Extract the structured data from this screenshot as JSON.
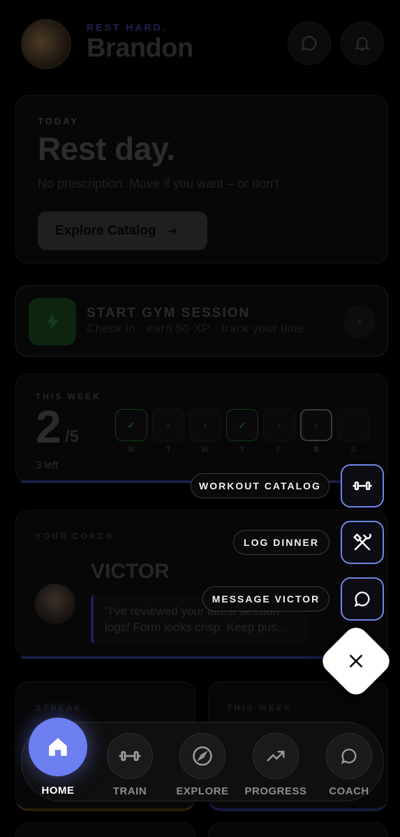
{
  "header": {
    "greeting": "REST HARD.",
    "username": "Brandon",
    "icons": [
      "chat-icon",
      "bell-icon"
    ]
  },
  "today": {
    "label": "TODAY",
    "title": "Rest day.",
    "subtitle": "No prescription. Move if you want – or don't.",
    "button_label": "Explore Catalog"
  },
  "gym_session": {
    "title": "START GYM SESSION",
    "subtitle": "Check in · earn 50 XP · track your time",
    "icon": "lightning-icon"
  },
  "this_week": {
    "label": "THIS WEEK",
    "completed": "2",
    "goal": "/5",
    "remaining": "3 left",
    "days": [
      {
        "letter": "M",
        "state": "done",
        "mark": "✓"
      },
      {
        "letter": "T",
        "state": "empty",
        "mark": "•"
      },
      {
        "letter": "W",
        "state": "empty",
        "mark": "•"
      },
      {
        "letter": "T",
        "state": "done",
        "mark": "✓"
      },
      {
        "letter": "F",
        "state": "empty",
        "mark": "•"
      },
      {
        "letter": "S",
        "state": "today",
        "mark": "•"
      },
      {
        "letter": "S",
        "state": "empty",
        "mark": ""
      }
    ]
  },
  "coach": {
    "label": "YOUR COACH",
    "name": "VICTOR",
    "quote": "\"I've reviewed your latest session logs! Form looks crisp. Keep pus..."
  },
  "stats": {
    "streak_label": "STREAK",
    "week_label": "THIS WEEK"
  },
  "quick_actions": [
    {
      "label": "WORKOUT CATALOG",
      "icon": "dumbbell-icon"
    },
    {
      "label": "LOG DINNER",
      "icon": "fork-knife-icon"
    },
    {
      "label": "MESSAGE VICTOR",
      "icon": "chat-icon"
    }
  ],
  "nav": {
    "items": [
      {
        "label": "HOME",
        "icon": "home-icon",
        "active": true
      },
      {
        "label": "TRAIN",
        "icon": "dumbbell-icon"
      },
      {
        "label": "EXPLORE",
        "icon": "compass-icon"
      },
      {
        "label": "PROGRESS",
        "icon": "trend-icon"
      },
      {
        "label": "COACH",
        "icon": "chat-icon"
      }
    ]
  },
  "colors": {
    "accent": "#6c7ef0",
    "action_border": "#6f86e6",
    "background": "#000000"
  }
}
